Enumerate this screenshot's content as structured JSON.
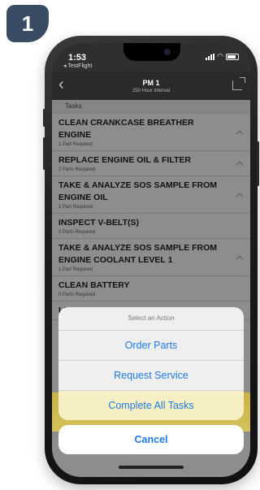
{
  "step_badge": "1",
  "status_bar": {
    "time": "1:53",
    "back_app": "◂ TestFlight"
  },
  "nav": {
    "title": "PM 1",
    "subtitle": "250 Hour Interval"
  },
  "tasks_header": "Tasks",
  "tasks": [
    {
      "name": "CLEAN CRANKCASE BREATHER ENGINE",
      "sub": "1 Part Required",
      "chevron": true
    },
    {
      "name": "REPLACE ENGINE OIL & FILTER",
      "sub": "2 Parts Required",
      "chevron": true
    },
    {
      "name": "TAKE & ANALYZE SOS SAMPLE FROM ENGINE OIL",
      "sub": "1 Part Required",
      "chevron": true
    },
    {
      "name": "INSPECT V-BELT(S)",
      "sub": "0 Parts Required",
      "chevron": false
    },
    {
      "name": "TAKE & ANALYZE SOS SAMPLE FROM ENGINE COOLANT LEVEL 1",
      "sub": "1 Part Required",
      "chevron": true
    },
    {
      "name": "CLEAN BATTERY",
      "sub": "0 Parts Required",
      "chevron": false
    },
    {
      "name": "LUBRICATE DRIVE SHAFT SPLINE",
      "sub": "",
      "chevron": false
    }
  ],
  "action_sheet": {
    "title": "Select an Action",
    "order_parts": "Order Parts",
    "request_service": "Request Service",
    "complete_all": "Complete All Tasks",
    "cancel": "Cancel"
  },
  "colors": {
    "accent": "#1f7ae0",
    "badge": "#3a4c63",
    "highlight": "#f6efc4"
  }
}
